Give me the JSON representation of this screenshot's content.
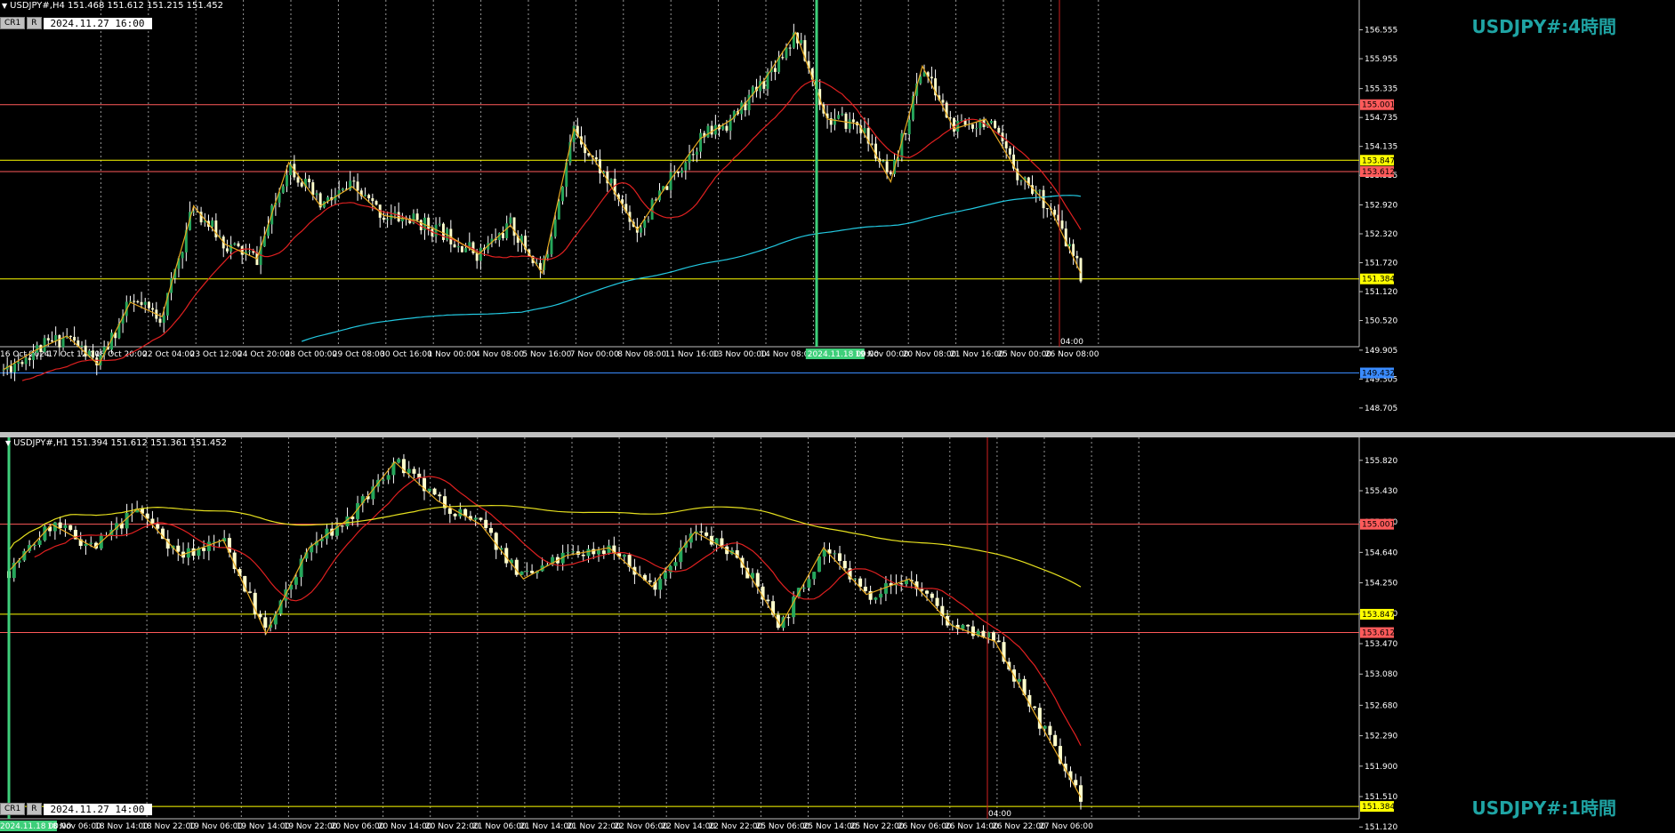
{
  "colors": {
    "bg": "#000000",
    "bull": "#26a65b",
    "bear": "#ffffcc",
    "wick": "#ffffff",
    "ma_red": "#e02020",
    "ma_cyan": "#22c8e0",
    "ma_yellow": "#e6e01e",
    "zigzag": "#e6a820",
    "line_red": "#ff5a5a",
    "line_yellow": "#ffff00",
    "line_blue": "#3a8cff",
    "title": "#1fa4a4",
    "vline_green": "#3ecf7a",
    "vline_red": "#d02020"
  },
  "top": {
    "header": "USDJPY#,H4  151.468 151.612 151.215 151.452",
    "tag_cr": "CR1",
    "tag_r": "R",
    "date_box": "2024.11.27  16:00",
    "title": "USDJPY#:4時間",
    "price_range": [
      148.5,
      157.1
    ],
    "y_labels": [
      "156.555",
      "155.955",
      "155.335",
      "154.735",
      "154.135",
      "153.535",
      "152.920",
      "152.320",
      "151.720",
      "151.120",
      "150.520",
      "149.905",
      "149.305",
      "148.705"
    ],
    "h_lines": [
      {
        "price": 155.001,
        "label": "155.001",
        "color": "#ff5a5a"
      },
      {
        "price": 153.847,
        "label": "153.847",
        "color": "#ffff00"
      },
      {
        "price": 153.612,
        "label": "153.612",
        "color": "#ff5a5a"
      },
      {
        "price": 151.384,
        "label": "151.384",
        "color": "#ffff00"
      },
      {
        "price": 149.432,
        "label": "149.432",
        "color": "#3a8cff"
      }
    ],
    "x_labels": [
      "16 Oct 2024",
      "17 Oct 12:00",
      "18 Oct 20:00",
      "22 Oct 04:00",
      "23 Oct 12:00",
      "24 Oct 20:00",
      "28 Oct 00:00",
      "29 Oct 08:00",
      "30 Oct 16:00",
      "1 Nov 00:00",
      "4 Nov 08:00",
      "5 Nov 16:00",
      "7 Nov 00:00",
      "8 Nov 08:00",
      "11 Nov 16:00",
      "13 Nov 00:00",
      "14 Nov 08:00",
      "2024.11.18 00:00",
      "19 Nov 00:00",
      "20 Nov 08:00",
      "21 Nov 16:00",
      "25 Nov 00:00",
      "26 Nov 08:00"
    ],
    "cursor_time": "04:00"
  },
  "bottom": {
    "header": "USDJPY#,H1  151.394 151.612 151.361 151.452",
    "tag_cr": "CR1",
    "tag_r": "R",
    "date_box": "2024.11.27  14:00",
    "title": "USDJPY#:1時間",
    "price_range": [
      151.1,
      156.0
    ],
    "y_labels": [
      "155.820",
      "155.430",
      "155.030",
      "154.640",
      "154.250",
      "153.860",
      "153.470",
      "153.080",
      "152.680",
      "152.290",
      "151.900",
      "151.510",
      "151.120"
    ],
    "h_lines": [
      {
        "price": 155.001,
        "label": "155.001",
        "color": "#ff5a5a"
      },
      {
        "price": 153.847,
        "label": "153.847",
        "color": "#ffff00"
      },
      {
        "price": 153.612,
        "label": "153.612",
        "color": "#ff5a5a"
      },
      {
        "price": 151.384,
        "label": "151.384",
        "color": "#ffff00"
      }
    ],
    "x_labels": [
      "2024.11.18 00:00",
      "18 Nov 06:00",
      "18 Nov 14:00",
      "18 Nov 22:00",
      "19 Nov 06:00",
      "19 Nov 14:00",
      "19 Nov 22:00",
      "20 Nov 06:00",
      "20 Nov 14:00",
      "20 Nov 22:00",
      "21 Nov 06:00",
      "21 Nov 14:00",
      "21 Nov 22:00",
      "22 Nov 06:00",
      "22 Nov 14:00",
      "22 Nov 22:00",
      "25 Nov 06:00",
      "25 Nov 14:00",
      "25 Nov 22:00",
      "26 Nov 06:00",
      "26 Nov 14:00",
      "26 Nov 22:00",
      "27 Nov 06:00"
    ],
    "cursor_time": "04:00"
  },
  "chart_data": [
    {
      "type": "line",
      "series": [
        {
          "name": "USDJPY#,H4",
          "values": [
            149.5,
            149.9,
            150.2,
            149.6,
            150.9,
            150.6,
            152.9,
            152.1,
            151.8,
            153.8,
            152.9,
            153.3,
            152.7,
            152.6,
            152.3,
            151.9,
            152.5,
            151.5,
            154.5,
            153.5,
            152.4,
            153.4,
            154.3,
            154.7,
            155.5,
            156.5,
            154.7,
            154.6,
            153.4,
            155.8,
            154.5,
            154.7,
            153.6,
            152.9,
            151.5
          ]
        }
      ]
    },
    {
      "type": "line",
      "series": [
        {
          "name": "USDJPY#,H1",
          "values": [
            154.4,
            155.0,
            154.7,
            155.2,
            154.6,
            154.8,
            153.6,
            154.7,
            155.1,
            155.8,
            155.3,
            155.0,
            154.3,
            154.6,
            154.7,
            154.2,
            154.9,
            154.6,
            153.7,
            154.7,
            154.1,
            154.3,
            153.7,
            153.5,
            152.5,
            151.5
          ]
        }
      ]
    }
  ]
}
